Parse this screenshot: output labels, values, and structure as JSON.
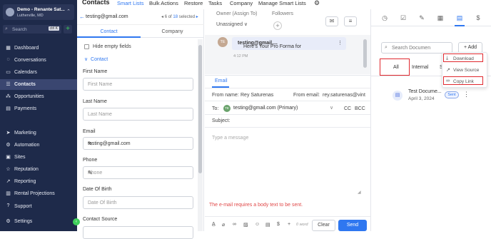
{
  "sidebar": {
    "account": {
      "name": "Demo - Renante Sat...",
      "location": "Lutherville, MD"
    },
    "search": {
      "placeholder": "Search",
      "shortcut": "ctrl K"
    },
    "items": [
      {
        "label": "Dashboard",
        "icon": "grid-icon"
      },
      {
        "label": "Conversations",
        "icon": "chat-icon"
      },
      {
        "label": "Calendars",
        "icon": "calendar-icon"
      },
      {
        "label": "Contacts",
        "icon": "contacts-icon",
        "active": true
      },
      {
        "label": "Opportunities",
        "icon": "opportunities-icon"
      },
      {
        "label": "Payments",
        "icon": "payments-icon"
      },
      {
        "label": "Marketing",
        "icon": "marketing-icon"
      },
      {
        "label": "Automation",
        "icon": "automation-icon"
      },
      {
        "label": "Sites",
        "icon": "sites-icon"
      },
      {
        "label": "Reputation",
        "icon": "star-icon"
      },
      {
        "label": "Reporting",
        "icon": "reporting-icon"
      },
      {
        "label": "Rental Projections",
        "icon": "projections-icon"
      },
      {
        "label": "Support",
        "icon": "support-icon"
      },
      {
        "label": "Settings",
        "icon": "gear-icon"
      }
    ]
  },
  "topnav": {
    "title": "Contacts",
    "items": [
      "Smart Lists",
      "Bulk Actions",
      "Restore",
      "Tasks",
      "Company",
      "Manage Smart Lists"
    ]
  },
  "contact": {
    "email": "testing@gmail.com",
    "position": "6",
    "total": "18",
    "pager_of": "of",
    "pager_selected": "selected",
    "tabs": [
      "Contact",
      "Company"
    ],
    "hide_empty": "Hide empty fields",
    "section": "Contact",
    "fields": [
      {
        "label": "First Name",
        "placeholder": "First Name"
      },
      {
        "label": "Last Name",
        "placeholder": "Last Name"
      },
      {
        "label": "Email",
        "value": "testing@gmail.com"
      },
      {
        "label": "Phone",
        "placeholder": "Phone"
      },
      {
        "label": "Date Of Birth",
        "placeholder": "Date Of Birth"
      },
      {
        "label": "Contact Source"
      }
    ]
  },
  "conversation": {
    "owner_label": "Owner (Assign To)",
    "owner_value": "Unassigned",
    "followers_label": "Followers",
    "avatar_initials": "TE",
    "message_email": "testing@gmail....",
    "message_text": "Here's Your Pro Forma for",
    "message_time": "4:12 PM",
    "compose_tab": "Email",
    "from_name_label": "From name:",
    "from_name": "Rey Saturenas",
    "from_email_label": "From email:",
    "from_email": "rey.saturenas@vint",
    "to_label": "To:",
    "to_initials": "TE",
    "to_value": "testing@gmail.com (Primary)",
    "cc": "CC",
    "bcc": "BCC",
    "subject_label": "Subject:",
    "body_placeholder": "Type a message",
    "error": "The e-mail requires a body text to be sent.",
    "word_count": "0 word",
    "clear": "Clear",
    "send": "Send"
  },
  "documents": {
    "search_placeholder": "Search Documen",
    "add": "+ Add",
    "tabs": [
      "All",
      "Internal",
      "S"
    ],
    "menu": [
      "Download",
      "View Source",
      "Copy Link"
    ],
    "doc": {
      "title": "Test Docume...",
      "date": "April 3, 2024",
      "status": "Sent"
    }
  },
  "colors": {
    "sidebar_bg": "#1e2a4a",
    "accent": "#2f77f0",
    "error": "#e04848",
    "highlight_box": "#e0282e"
  }
}
